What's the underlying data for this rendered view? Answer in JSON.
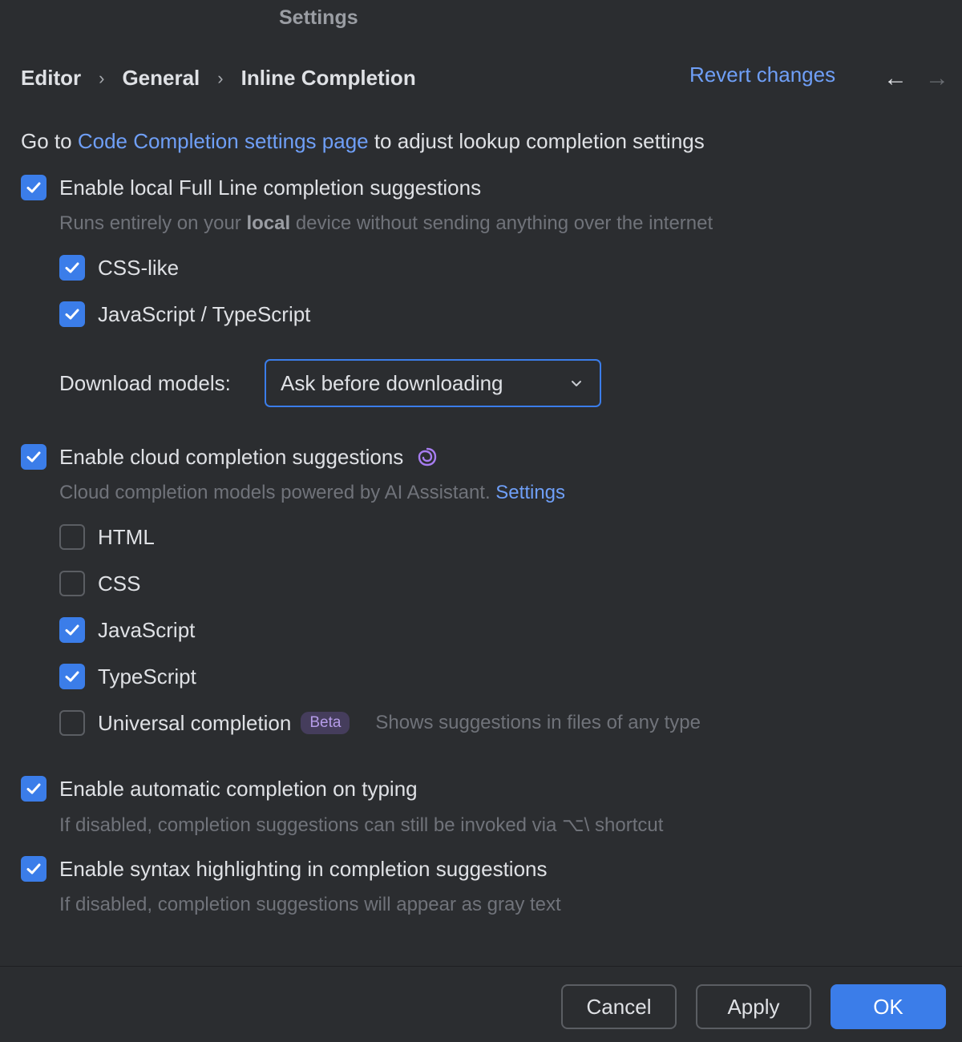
{
  "window": {
    "title": "Settings"
  },
  "breadcrumb": [
    "Editor",
    "General",
    "Inline Completion"
  ],
  "header": {
    "revert_label": "Revert changes"
  },
  "intro": {
    "prefix": "Go to ",
    "link": "Code Completion settings page",
    "suffix": " to adjust lookup completion settings"
  },
  "local": {
    "label": "Enable local Full Line completion suggestions",
    "checked": true,
    "hint_pre": "Runs entirely on your ",
    "hint_bold": "local",
    "hint_post": " device without sending anything over the internet",
    "languages": [
      {
        "label": "CSS-like",
        "checked": true
      },
      {
        "label": "JavaScript / TypeScript",
        "checked": true
      }
    ],
    "download_label": "Download models:",
    "download_value": "Ask before downloading"
  },
  "cloud": {
    "label": "Enable cloud completion suggestions",
    "checked": true,
    "hint": "Cloud completion models powered by AI Assistant.",
    "hint_link": "Settings",
    "languages": [
      {
        "label": "HTML",
        "checked": false
      },
      {
        "label": "CSS",
        "checked": false
      },
      {
        "label": "JavaScript",
        "checked": true
      },
      {
        "label": "TypeScript",
        "checked": true
      }
    ],
    "universal": {
      "label": "Universal completion",
      "checked": false,
      "badge": "Beta",
      "hint": "Shows suggestions in files of any type"
    }
  },
  "auto": {
    "label": "Enable automatic completion on typing",
    "checked": true,
    "hint": "If disabled, completion suggestions can still be invoked via ⌥\\ shortcut"
  },
  "syntax": {
    "label": "Enable syntax highlighting in completion suggestions",
    "checked": true,
    "hint": "If disabled, completion suggestions will appear as gray text"
  },
  "footer": {
    "cancel": "Cancel",
    "apply": "Apply",
    "ok": "OK"
  },
  "colors": {
    "accent": "#3b7de9",
    "link": "#6f9ff7",
    "background": "#2b2d30",
    "beta": "#b59ce8"
  }
}
